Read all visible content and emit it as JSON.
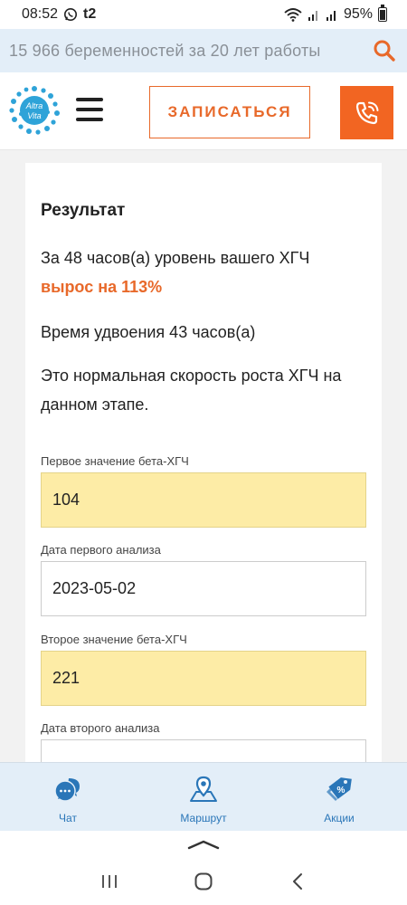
{
  "status_bar": {
    "time": "08:52",
    "carrier": "t2",
    "battery": "95%"
  },
  "banner": {
    "text": "15 966 беременностей за 20 лет работы"
  },
  "header": {
    "logo_text_top": "Altra",
    "logo_text_bottom": "Vita",
    "signup_label": "ЗАПИСАТЬСЯ"
  },
  "result": {
    "title": "Результат",
    "line1_prefix": "За 48 часов(а) уровень вашего ХГЧ ",
    "line1_highlight": "вырос на 113%",
    "doubling": "Время удвоения 43 часов(а)",
    "verdict": "Это нормальная скорость роста ХГЧ на данном этапе."
  },
  "form": {
    "first_value_label": "Первое значение бета-ХГЧ",
    "first_value": "104",
    "first_date_label": "Дата первого анализа",
    "first_date": "2023-05-02",
    "second_value_label": "Второе значение бета-ХГЧ",
    "second_value": "221",
    "second_date_label": "Дата второго анализа",
    "second_date": ""
  },
  "bottom_nav": {
    "items": [
      {
        "label": "Чат",
        "icon": "chat-icon"
      },
      {
        "label": "Маршрут",
        "icon": "route-pin-icon"
      },
      {
        "label": "Акции",
        "icon": "sale-tag-icon"
      }
    ]
  },
  "colors": {
    "accent": "#e8692a",
    "call_button": "#f26522",
    "nav_blue": "#2a76b8",
    "highlight_field": "#fdeca6"
  }
}
